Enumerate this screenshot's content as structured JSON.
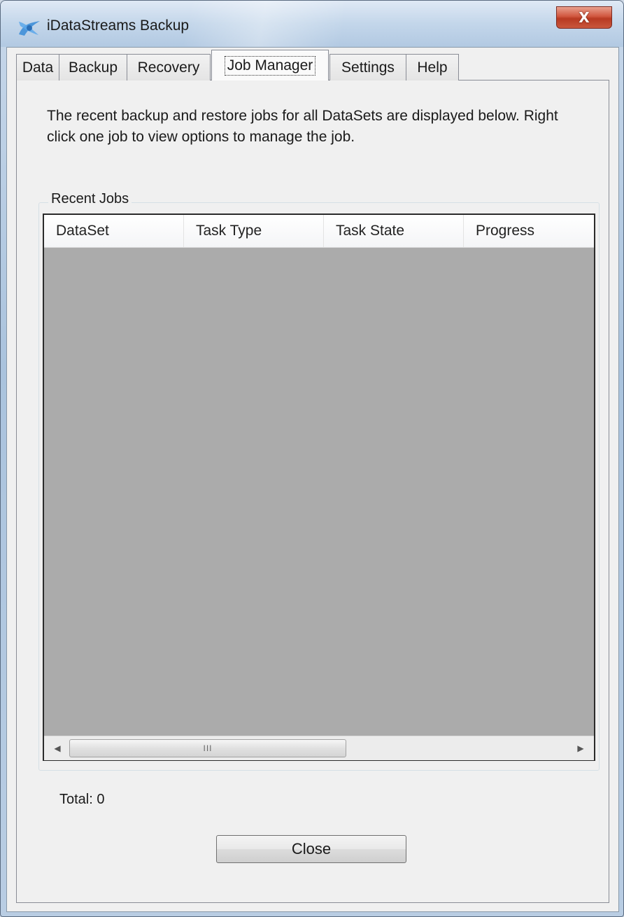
{
  "window": {
    "title": "iDataStreams Backup",
    "close_glyph": "X",
    "app_icon": "idatastreams-logo"
  },
  "tabs": [
    {
      "label": "Data"
    },
    {
      "label": "Backup"
    },
    {
      "label": "Recovery"
    },
    {
      "label": "Job Manager",
      "active": true
    },
    {
      "label": "Settings"
    },
    {
      "label": "Help"
    }
  ],
  "job_manager": {
    "intro": "The recent backup and restore jobs for all DataSets are displayed below. Right click one job to view options to manage the job.",
    "group_title": "Recent Jobs",
    "columns": [
      "DataSet",
      "Task Type",
      "Task State",
      "Progress"
    ],
    "rows": [],
    "scroll_thumb_grip": "III",
    "total_label": "Total: 0",
    "close_label": "Close"
  },
  "colors": {
    "table_empty_bg": "#ababab",
    "close_x_bg": "#c9573d"
  }
}
